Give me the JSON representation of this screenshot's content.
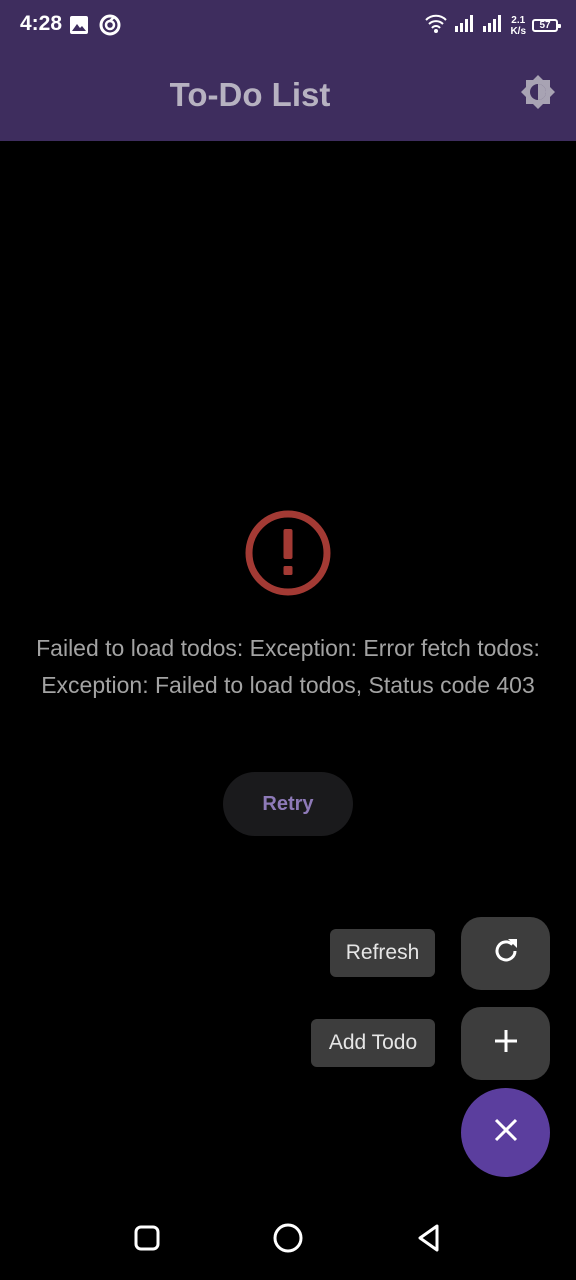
{
  "status_bar": {
    "time": "4:28",
    "net_speed_value": "2.1",
    "net_speed_unit": "K/s",
    "battery_level": "57",
    "icons": [
      "image-icon",
      "sync-app-icon",
      "wifi-icon",
      "signal-icon",
      "signal-icon-2",
      "battery-icon"
    ]
  },
  "app_bar": {
    "title": "To-Do List",
    "action_icon": "brightness-icon"
  },
  "error": {
    "icon": "error-icon",
    "message": "Failed to load todos: Exception: Error fetch todos: Exception: Failed to load todos, Status code 403",
    "retry_label": "Retry"
  },
  "speed_dial": {
    "refresh_label": "Refresh",
    "add_label": "Add Todo",
    "refresh_icon": "refresh-icon",
    "add_icon": "plus-icon",
    "close_icon": "close-icon"
  },
  "nav_bar": {
    "icons": [
      "recents-icon",
      "home-icon",
      "back-icon"
    ]
  },
  "colors": {
    "app_bar": "#3e2d5e",
    "background": "#000000",
    "error_red": "#a33a34",
    "accent": "#5b3e9e",
    "retry_text": "#8e7ab8",
    "fab_secondary": "#3d3d3d"
  }
}
